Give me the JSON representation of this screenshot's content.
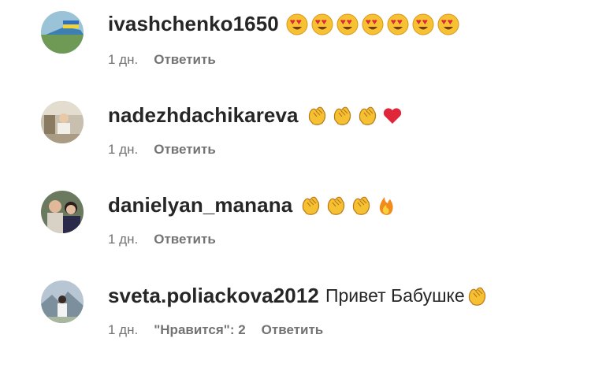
{
  "comments": [
    {
      "username": "ivashchenko1650",
      "text": "",
      "emojis": [
        "heart-eyes",
        "heart-eyes",
        "heart-eyes",
        "heart-eyes",
        "heart-eyes",
        "heart-eyes",
        "heart-eyes"
      ],
      "time": "1 дн.",
      "likes": "",
      "reply": "Ответить"
    },
    {
      "username": "nadezhdachikareva",
      "text": "",
      "emojis": [
        "clap",
        "clap",
        "clap",
        "red-heart"
      ],
      "time": "1 дн.",
      "likes": "",
      "reply": "Ответить"
    },
    {
      "username": "danielyan_manana",
      "text": "",
      "emojis": [
        "clap",
        "clap",
        "clap",
        "fire"
      ],
      "time": "1 дн.",
      "likes": "",
      "reply": "Ответить"
    },
    {
      "username": "sveta.poliackova2012",
      "text": "Привет Бабушке",
      "emojis": [
        "clap"
      ],
      "time": "1 дн.",
      "likes": "\"Нравится\": 2",
      "reply": "Ответить"
    }
  ],
  "colors": {
    "username": "#262626",
    "meta": "#737373",
    "heart": "#e0263a",
    "clap": "#f5c132",
    "fire": "#f28a1c"
  }
}
